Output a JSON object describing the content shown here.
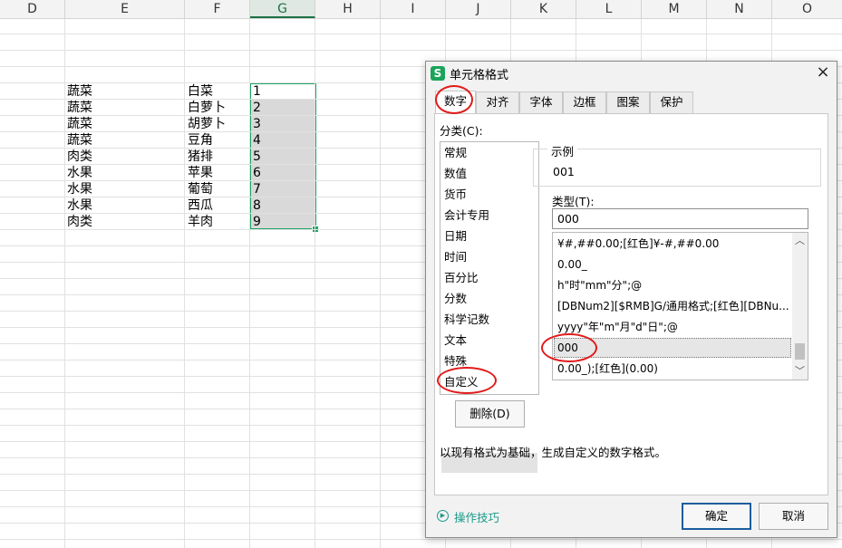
{
  "columns": [
    "D",
    "E",
    "F",
    "G",
    "H",
    "I",
    "J",
    "K",
    "L",
    "M",
    "N",
    "O"
  ],
  "rows": [
    {
      "category": "蔬菜",
      "item": "白菜",
      "value": "1"
    },
    {
      "category": "蔬菜",
      "item": "白萝卜",
      "value": "2"
    },
    {
      "category": "蔬菜",
      "item": "胡萝卜",
      "value": "3"
    },
    {
      "category": "蔬菜",
      "item": "豆角",
      "value": "4"
    },
    {
      "category": "肉类",
      "item": "猪排",
      "value": "5"
    },
    {
      "category": "水果",
      "item": "苹果",
      "value": "6"
    },
    {
      "category": "水果",
      "item": "葡萄",
      "value": "7"
    },
    {
      "category": "水果",
      "item": "西瓜",
      "value": "8"
    },
    {
      "category": "肉类",
      "item": "羊肉",
      "value": "9"
    }
  ],
  "dialog": {
    "app_icon": "S",
    "title": "单元格格式",
    "close": "×",
    "tabs": [
      "数字",
      "对齐",
      "字体",
      "边框",
      "图案",
      "保护"
    ],
    "category_label": "分类(C):",
    "categories": [
      "常规",
      "数值",
      "货币",
      "会计专用",
      "日期",
      "时间",
      "百分比",
      "分数",
      "科学记数",
      "文本",
      "特殊",
      "自定义"
    ],
    "delete_button": "删除(D)",
    "sample_label": "示例",
    "sample_value": "001",
    "type_label": "类型(T):",
    "type_value": "000",
    "formats": [
      "¥#,##0.00;[红色]¥-#,##0.00",
      "0.00_",
      "h\"时\"mm\"分\";@",
      "[DBNum2][$RMB]G/通用格式;[红色][DBNu...",
      "yyyy\"年\"m\"月\"d\"日\";@",
      "000",
      "0.00_);[红色](0.00)"
    ],
    "description": "以现有格式为基础，生成自定义的数字格式。",
    "help_link": "操作技巧",
    "ok_button": "确定",
    "cancel_button": "取消"
  },
  "colors": {
    "selection": "#21a366",
    "highlight_ring": "#e11b1b",
    "app_icon": "#1ba35a"
  }
}
